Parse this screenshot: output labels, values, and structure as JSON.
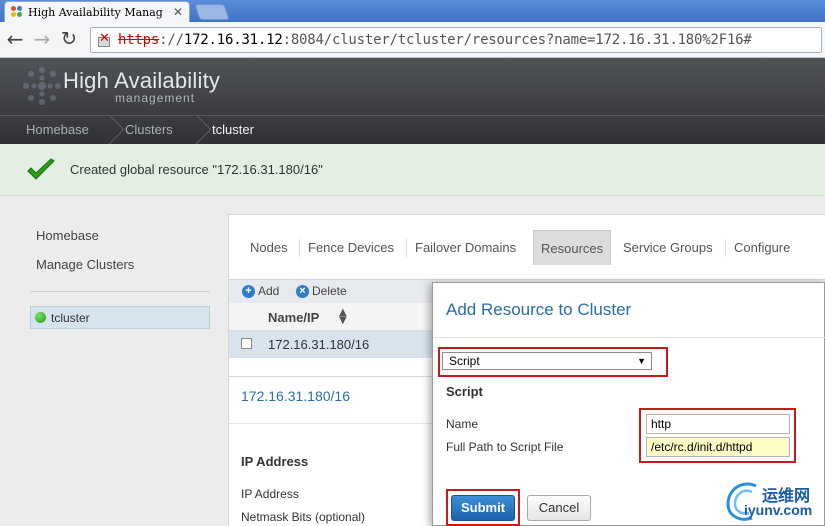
{
  "browser": {
    "tab_title": "High Availability Manag",
    "url_protocol": "https",
    "url_sep": "://",
    "url_host": "172.16.31.12",
    "url_rest": ":8084/cluster/tcluster/resources?name=172.16.31.180%2F16#"
  },
  "app": {
    "title": "High Availability",
    "subtitle": "management"
  },
  "breadcrumb": [
    "Homebase",
    "Clusters",
    "tcluster"
  ],
  "notification": "Created global resource \"172.16.31.180/16\"",
  "sidebar": {
    "links": [
      "Homebase",
      "Manage Clusters"
    ],
    "cluster": "tcluster"
  },
  "tabs": [
    "Nodes",
    "Fence Devices",
    "Failover Domains",
    "Resources",
    "Service Groups",
    "Configure"
  ],
  "actions": {
    "add": "Add",
    "delete": "Delete",
    "add_icon": "+",
    "delete_icon": "×"
  },
  "table": {
    "column": "Name/IP",
    "rows": [
      "172.16.31.180/16"
    ]
  },
  "detail": {
    "title": "172.16.31.180/16",
    "heading": "IP Address",
    "fields": [
      "IP Address",
      "Netmask Bits (optional)"
    ]
  },
  "modal": {
    "title": "Add Resource to Cluster",
    "type_selected": "Script",
    "section": "Script",
    "name_label": "Name",
    "name_value": "http",
    "path_label": "Full Path to Script File",
    "path_value": "/etc/rc.d/init.d/httpd",
    "submit": "Submit",
    "cancel": "Cancel"
  },
  "watermark": {
    "cn": "运维网",
    "en": "iyunv.com"
  },
  "colors": {
    "accent_blue": "#2a6ea8",
    "highlight_red": "#c61b1b",
    "success_green": "#2d9a1a"
  }
}
